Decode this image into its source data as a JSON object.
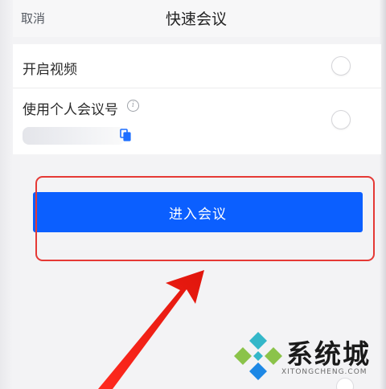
{
  "header": {
    "cancel_label": "取消",
    "title": "快速会议"
  },
  "settings": {
    "video_label": "开启视频",
    "video_enabled": false,
    "pmi_label": "使用个人会议号",
    "pmi_enabled": false
  },
  "enter_button": {
    "label": "进入会议",
    "color": "#0b5fff"
  },
  "annotation": {
    "highlight_color": "#e53935"
  },
  "watermark": {
    "text": "系统城",
    "subtext": "XITONGCHENG.COM",
    "logo_colors": [
      "#34b7c9",
      "#8bc34a",
      "#1e88e5"
    ]
  },
  "icons": {
    "info": "info-icon",
    "copy": "copy-icon"
  }
}
